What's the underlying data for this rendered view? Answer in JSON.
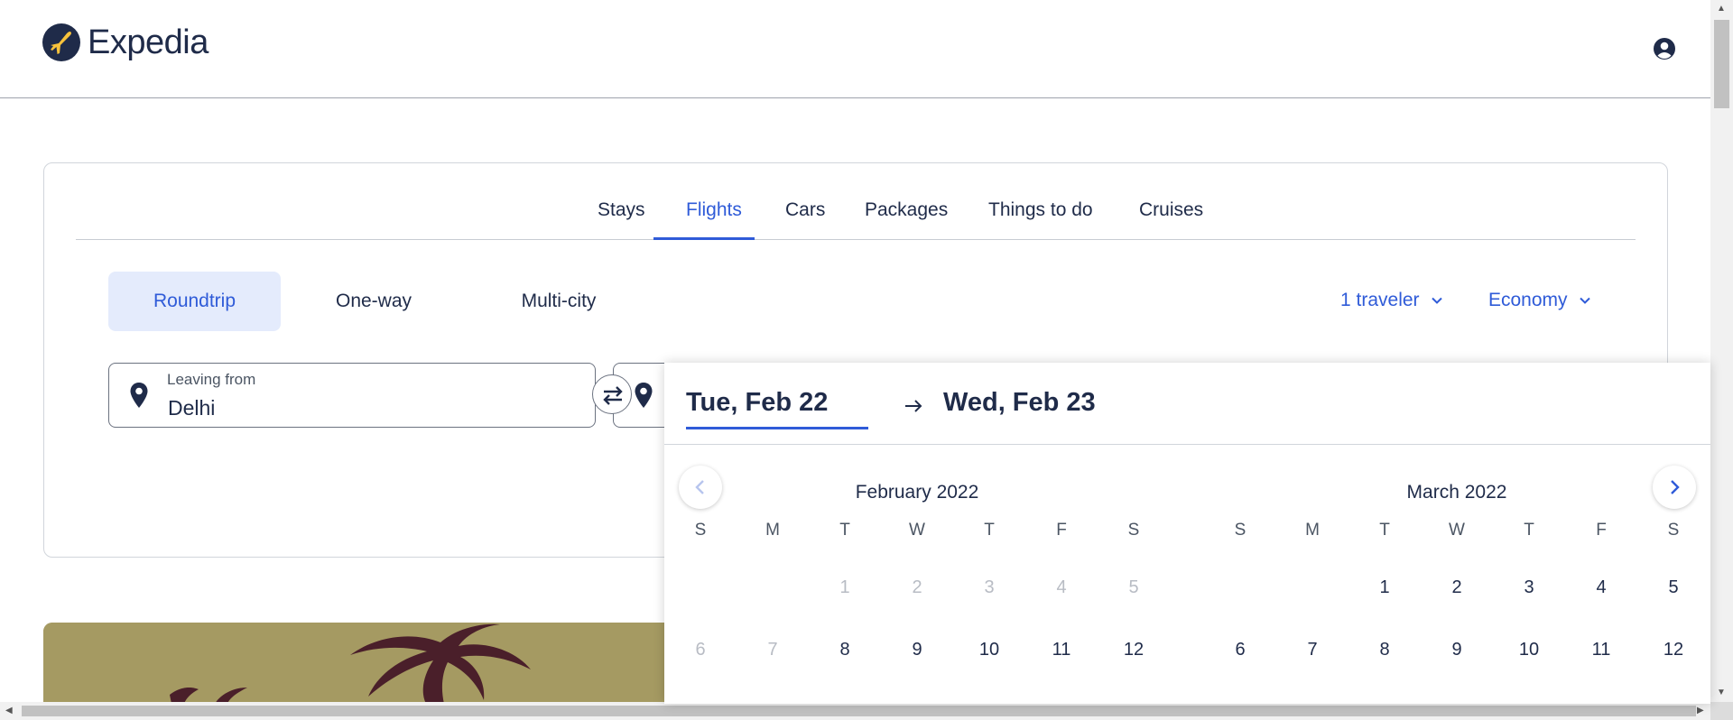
{
  "header": {
    "brand": "Expedia",
    "logo_icon": "plane-logo-icon",
    "account_icon": "account-icon",
    "colors": {
      "brand": "#1f2b49",
      "accent": "#2f5bd8",
      "plane": "#f7c23b"
    }
  },
  "tabs": [
    {
      "label": "Stays",
      "active": false
    },
    {
      "label": "Flights",
      "active": true
    },
    {
      "label": "Cars",
      "active": false
    },
    {
      "label": "Packages",
      "active": false
    },
    {
      "label": "Things to do",
      "active": false
    },
    {
      "label": "Cruises",
      "active": false
    }
  ],
  "trip_types": [
    {
      "label": "Roundtrip",
      "active": true
    },
    {
      "label": "One-way",
      "active": false
    },
    {
      "label": "Multi-city",
      "active": false
    }
  ],
  "travelers": {
    "label": "1 traveler"
  },
  "cabin": {
    "label": "Economy"
  },
  "leaving_from": {
    "label": "Leaving from",
    "value": "Delhi"
  },
  "date_picker": {
    "from": "Tue, Feb 22",
    "to": "Wed, Feb 23",
    "weekday_headers": [
      "S",
      "M",
      "T",
      "W",
      "T",
      "F",
      "S"
    ],
    "months": [
      {
        "title": "February 2022",
        "weeks": [
          [
            "",
            "",
            "1",
            "2",
            "3",
            "4",
            "5"
          ],
          [
            "6",
            "7",
            "8",
            "9",
            "10",
            "11",
            "12"
          ]
        ],
        "disabled": [
          "1",
          "2",
          "3",
          "4",
          "5",
          "6",
          "7"
        ]
      },
      {
        "title": "March 2022",
        "weeks": [
          [
            "",
            "",
            "1",
            "2",
            "3",
            "4",
            "5"
          ],
          [
            "6",
            "7",
            "8",
            "9",
            "10",
            "11",
            "12"
          ]
        ],
        "disabled": []
      }
    ]
  }
}
